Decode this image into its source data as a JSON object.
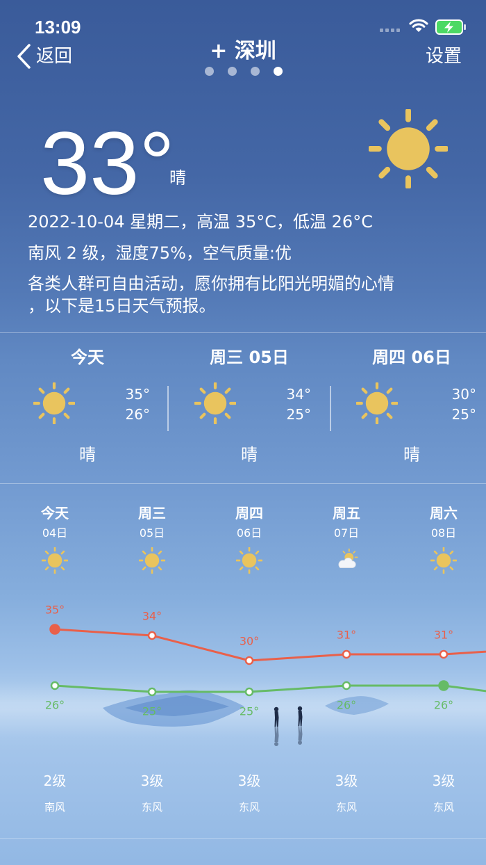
{
  "status_bar": {
    "time": "13:09",
    "battery_color": "#4cd964"
  },
  "nav": {
    "back_label": "返回",
    "city_title": "+ 深圳",
    "settings_label": "设置",
    "page_count": 4,
    "active_page_index": 3
  },
  "current": {
    "temperature": "33°",
    "condition": "晴",
    "icon": "sun-icon",
    "summary_line": "2022-10-04 星期二，高温 35°C，低温 26°C",
    "detail_line": "南风 2 级，湿度75%，空气质量:优",
    "advice_line1": "各类人群可自由活动，愿你拥有比阳光明媚的心情",
    "advice_line2": "，以下是15日天气预报。"
  },
  "three_day": [
    {
      "label": "今天",
      "icon": "sun-icon",
      "high": "35°",
      "low": "26°",
      "condition": "晴"
    },
    {
      "label": "周三 05日",
      "icon": "sun-icon",
      "high": "34°",
      "low": "25°",
      "condition": "晴"
    },
    {
      "label": "周四 06日",
      "icon": "sun-icon",
      "high": "30°",
      "low": "25°",
      "condition": "晴"
    }
  ],
  "forecast": {
    "temp_unit": "°",
    "days": [
      {
        "weekday": "今天",
        "date": "04日",
        "icon": "sun-icon",
        "high": 35,
        "low": 26,
        "wind_level": "2级",
        "wind_dir": "南风"
      },
      {
        "weekday": "周三",
        "date": "05日",
        "icon": "sun-icon",
        "high": 34,
        "low": 25,
        "wind_level": "3级",
        "wind_dir": "东风"
      },
      {
        "weekday": "周四",
        "date": "06日",
        "icon": "sun-icon",
        "high": 30,
        "low": 25,
        "wind_level": "3级",
        "wind_dir": "东风"
      },
      {
        "weekday": "周五",
        "date": "07日",
        "icon": "partly-cloudy-icon",
        "high": 31,
        "low": 26,
        "wind_level": "3级",
        "wind_dir": "东风"
      },
      {
        "weekday": "周六",
        "date": "08日",
        "icon": "sun-icon",
        "high": 31,
        "low": 26,
        "wind_level": "3级",
        "wind_dir": "东风"
      }
    ],
    "next_day_partial": {
      "high": 32,
      "low": 24
    },
    "filled_point_index": {
      "high": 0,
      "low": 4
    },
    "high_color": "#e9604a",
    "low_color": "#66bb66"
  },
  "colors": {
    "sun": "#e9c45e"
  }
}
